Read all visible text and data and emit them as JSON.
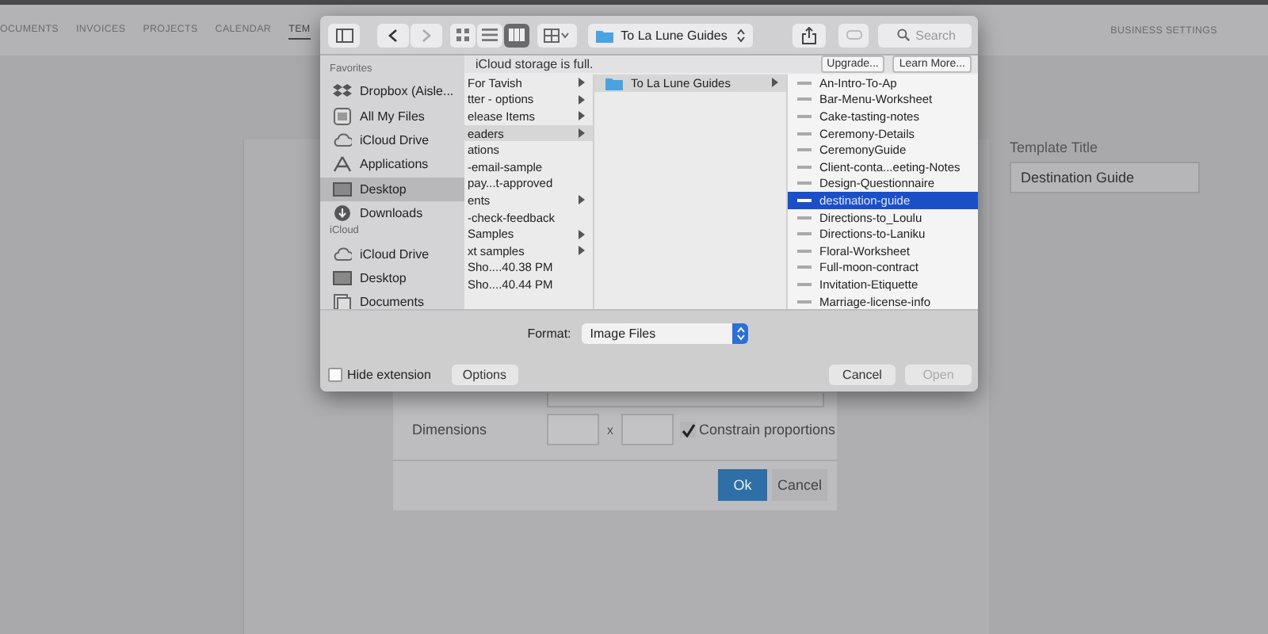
{
  "nav": {
    "tabs": [
      {
        "label": "OCUMENTS",
        "selected": false
      },
      {
        "label": "INVOICES",
        "selected": false
      },
      {
        "label": "PROJECTS",
        "selected": false
      },
      {
        "label": "CALENDAR",
        "selected": false
      },
      {
        "label": "TEM",
        "selected": true
      }
    ],
    "settings_link": "BUSINESS SETTINGS"
  },
  "template_title": {
    "label": "Template Title",
    "value": "Destination Guide"
  },
  "image_dialog": {
    "dimensions_label": "Dimensions",
    "times": "x",
    "constrain": {
      "label": "Constrain proportions",
      "checked": true
    },
    "buttons": [
      {
        "label": "Ok",
        "kind": "primary"
      },
      {
        "label": "Cancel",
        "kind": "secondary"
      }
    ]
  },
  "file_picker": {
    "path": "To La Lune Guides",
    "search": {
      "placeholder": "Search"
    },
    "view_modes": [
      {
        "selected": false
      },
      {
        "selected": false
      },
      {
        "selected": true
      }
    ],
    "sidebar": [
      {
        "heading": "Favorites",
        "items": [
          {
            "label": "Dropbox (Aisle...",
            "kind": "dropbox",
            "selected": false
          },
          {
            "label": "All My Files",
            "kind": "files",
            "selected": false
          },
          {
            "label": "iCloud Drive",
            "kind": "cloud",
            "selected": false
          },
          {
            "label": "Applications",
            "kind": "apps",
            "selected": false
          },
          {
            "label": "Desktop",
            "kind": "desktop",
            "selected": true
          },
          {
            "label": "Downloads",
            "kind": "downloads",
            "selected": false
          }
        ]
      },
      {
        "heading": "iCloud",
        "items": [
          {
            "label": "iCloud Drive",
            "kind": "cloud",
            "selected": false
          },
          {
            "label": "Desktop",
            "kind": "desktop",
            "selected": false
          },
          {
            "label": "Documents",
            "kind": "documents",
            "selected": false
          }
        ]
      }
    ],
    "notice": {
      "text": "iCloud storage is full.",
      "buttons": [
        "Upgrade...",
        "Learn More..."
      ]
    },
    "columns": [
      {
        "focused": false,
        "items": [
          {
            "name": "For Tavish",
            "folder": true,
            "selected": false
          },
          {
            "name": "tter - options",
            "folder": true,
            "selected": false
          },
          {
            "name": "elease Items",
            "folder": true,
            "selected": false
          },
          {
            "name": "eaders",
            "folder": true,
            "selected": true
          },
          {
            "name": "ations",
            "folder": false,
            "selected": false
          },
          {
            "name": "-email-sample",
            "folder": false,
            "selected": false
          },
          {
            "name": "pay...t-approved",
            "folder": false,
            "selected": false
          },
          {
            "name": "ents",
            "folder": true,
            "selected": false
          },
          {
            "name": "-check-feedback",
            "folder": false,
            "selected": false
          },
          {
            "name": "Samples",
            "folder": true,
            "selected": false
          },
          {
            "name": "xt samples",
            "folder": true,
            "selected": false
          },
          {
            "name": "Sho....40.38 PM",
            "folder": false,
            "selected": false
          },
          {
            "name": "Sho....40.44 PM",
            "folder": false,
            "selected": false
          }
        ]
      },
      {
        "focused": false,
        "items": [
          {
            "name": "To La Lune Guides",
            "folder": true,
            "selected": true
          }
        ]
      },
      {
        "focused": true,
        "items": [
          {
            "name": "An-Intro-To-Ap",
            "folder": false,
            "selected": false
          },
          {
            "name": "Bar-Menu-Worksheet",
            "folder": false,
            "selected": false
          },
          {
            "name": "Cake-tasting-notes",
            "folder": false,
            "selected": false
          },
          {
            "name": "Ceremony-Details",
            "folder": false,
            "selected": false
          },
          {
            "name": "CeremonyGuide",
            "folder": false,
            "selected": false
          },
          {
            "name": "Client-conta...eeting-Notes",
            "folder": false,
            "selected": false
          },
          {
            "name": "Design-Questionnaire",
            "folder": false,
            "selected": false
          },
          {
            "name": "destination-guide",
            "folder": false,
            "selected": true
          },
          {
            "name": "Directions-to_Loulu",
            "folder": false,
            "selected": false
          },
          {
            "name": "Directions-to-Laniku",
            "folder": false,
            "selected": false
          },
          {
            "name": "Floral-Worksheet",
            "folder": false,
            "selected": false
          },
          {
            "name": "Full-moon-contract",
            "folder": false,
            "selected": false
          },
          {
            "name": "Invitation-Etiquette",
            "folder": false,
            "selected": false
          },
          {
            "name": "Marriage-license-info",
            "folder": false,
            "selected": false
          }
        ]
      }
    ],
    "format": {
      "label": "Format:",
      "value": "Image Files"
    },
    "hide_extension": {
      "label": "Hide extension",
      "checked": false
    },
    "buttons": [
      {
        "label": "Options",
        "kind": "left",
        "disabled": false
      },
      {
        "label": "Cancel",
        "kind": "right",
        "disabled": false
      },
      {
        "label": "Open",
        "kind": "right",
        "disabled": true
      }
    ]
  }
}
